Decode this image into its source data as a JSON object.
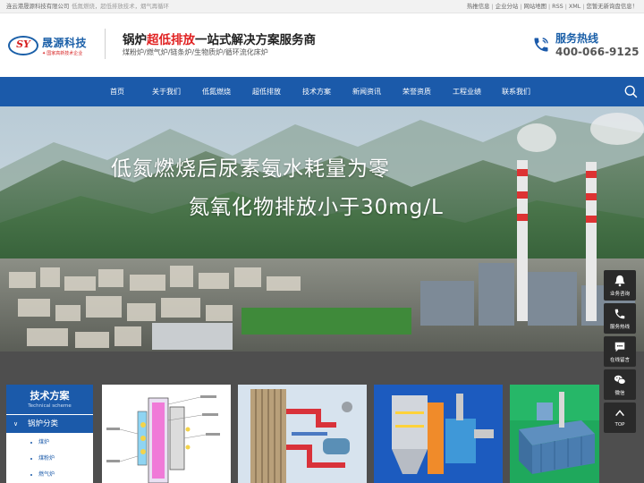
{
  "topbar": {
    "company": "连云港晟源科技有限公司",
    "slogan": "低氮燃烧，超低排放技术，烟气再循环",
    "links": [
      "热推信息",
      "企业分站",
      "网站地图",
      "RSS",
      "XML",
      "您暂无新询盘信息！"
    ]
  },
  "header": {
    "logo_mark": "SY",
    "logo_name": "晟源科技",
    "logo_sub": "国家高新技术企业",
    "title_prefix": "锅炉",
    "title_highlight": "超低排放",
    "title_suffix": "一站式解决方案服务商",
    "subtitle": "煤粉炉/燃气炉/链条炉/生物质炉/循环流化床炉",
    "hotline_label": "服务热线",
    "hotline_number": "400-066-9125"
  },
  "nav": {
    "items": [
      "首页",
      "关于我们",
      "低氮燃烧",
      "超低排放",
      "技术方案",
      "新闻资讯",
      "荣誉资质",
      "工程业绩",
      "联系我们"
    ],
    "search_icon": "search-icon"
  },
  "banner": {
    "line1": "低氮燃烧后尿素氨水耗量为零",
    "line2": "氮氧化物排放小于30mg/L"
  },
  "sidebar": {
    "title": "技术方案",
    "title_en": "Technical scheme",
    "category": "锅炉分类",
    "items": [
      "煤炉",
      "煤粉炉",
      "燃气炉"
    ]
  },
  "float_bar": {
    "items": [
      {
        "label": "业务咨询",
        "icon": "consult-icon"
      },
      {
        "label": "服务热线",
        "icon": "phone-icon"
      },
      {
        "label": "在线留言",
        "icon": "message-icon"
      },
      {
        "label": "微信",
        "icon": "wechat-icon"
      },
      {
        "label": "TOP",
        "icon": "arrow-up-icon"
      }
    ]
  },
  "colors": {
    "brand_blue": "#1b5aaa",
    "accent_red": "#e02020",
    "dark_panel": "#4e4e4e"
  }
}
